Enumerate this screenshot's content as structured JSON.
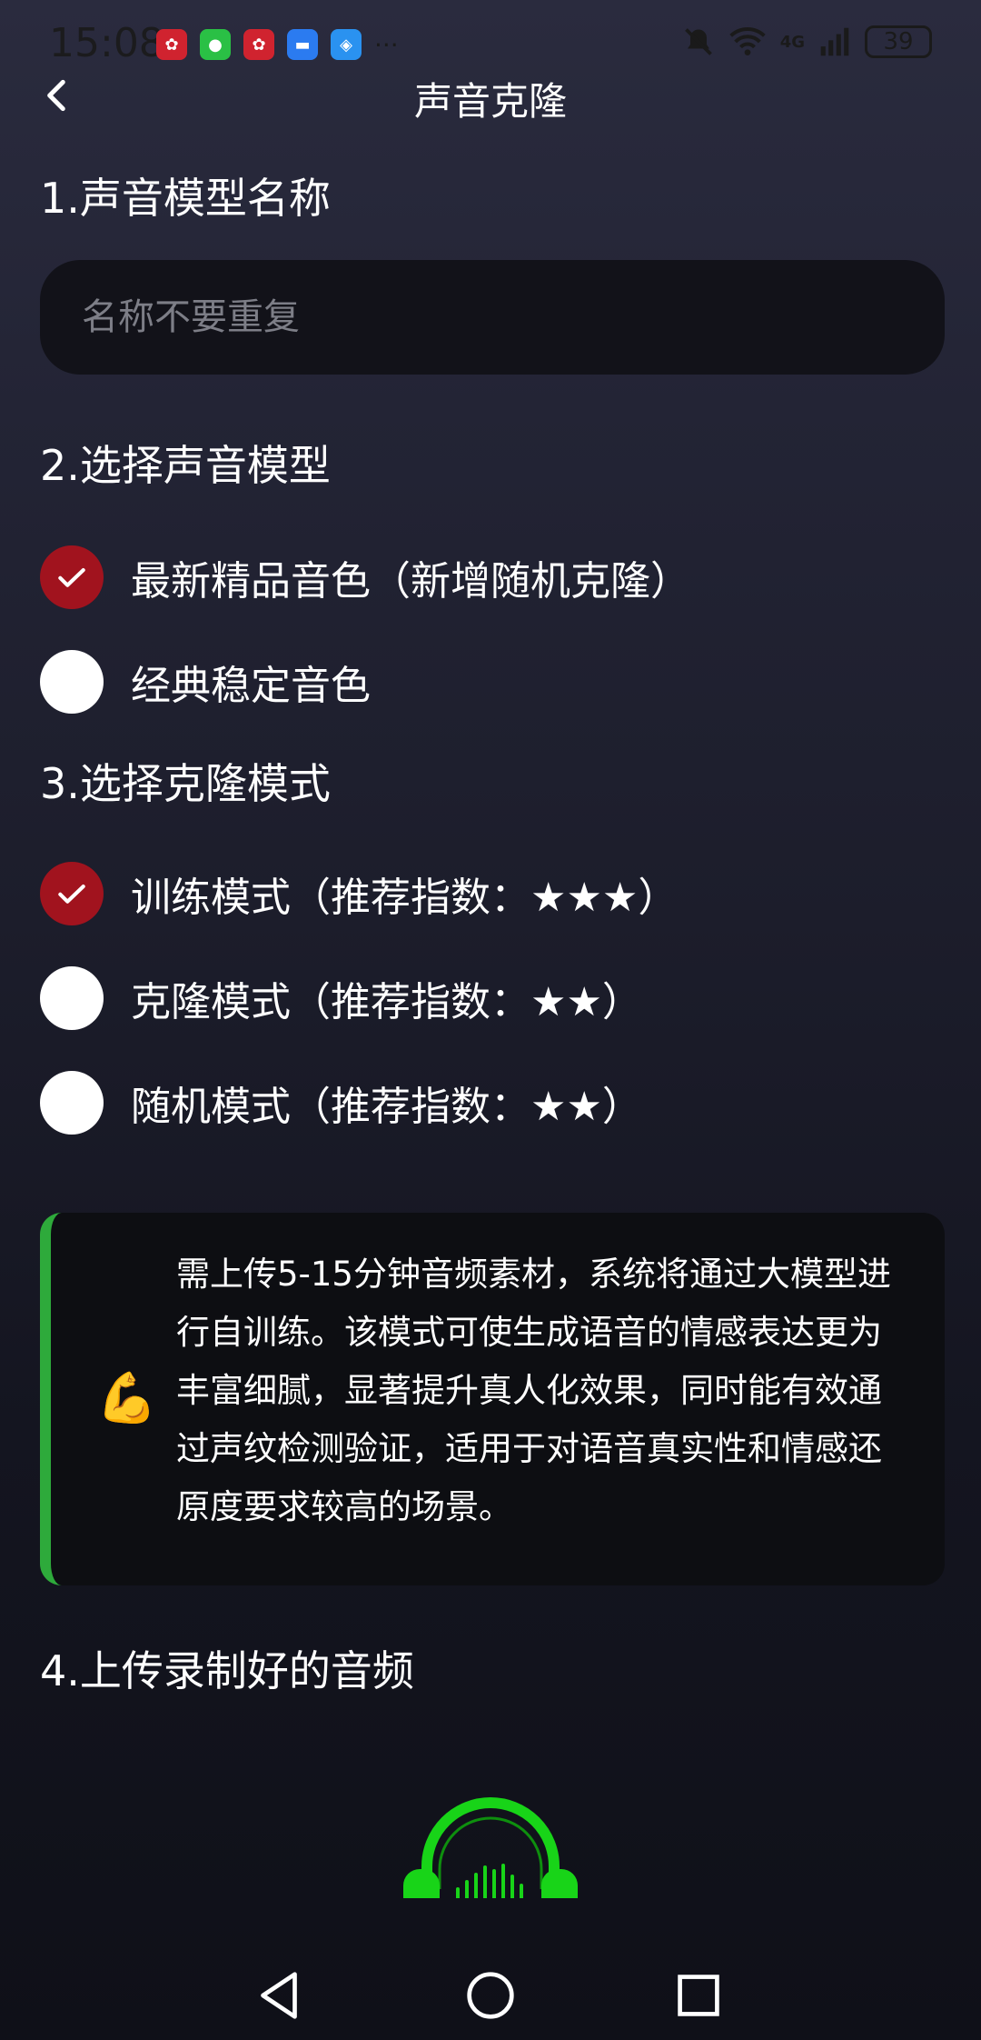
{
  "status": {
    "time": "15:08",
    "notif_more": "···",
    "network": "4G",
    "battery": "39"
  },
  "header": {
    "title": "声音克隆"
  },
  "section1": {
    "title": "1.声音模型名称",
    "input_placeholder": "名称不要重复",
    "input_value": ""
  },
  "section2": {
    "title": "2.选择声音模型",
    "options": [
      {
        "label": "最新精品音色（新增随机克隆）",
        "checked": true
      },
      {
        "label": "经典稳定音色",
        "checked": false
      }
    ]
  },
  "section3": {
    "title": "3.选择克隆模式",
    "options": [
      {
        "label": "训练模式（推荐指数：★★★）",
        "checked": true
      },
      {
        "label": "克隆模式（推荐指数：★★）",
        "checked": false
      },
      {
        "label": "随机模式（推荐指数：★★）",
        "checked": false
      }
    ]
  },
  "info": {
    "emoji": "💪",
    "text": "需上传5-15分钟音频素材，系统将通过大模型进行自训练。该模式可使生成语音的情感表达更为丰富细腻，显著提升真人化效果，同时能有效通过声纹检测验证，适用于对语音真实性和情感还原度要求较高的场景。"
  },
  "section4": {
    "title": "4.上传录制好的音频"
  },
  "colors": {
    "accent_red": "#a1131e",
    "accent_green": "#2eaa3b",
    "headphones_green": "#18d418"
  },
  "icons": {
    "back": "chevron-left-icon",
    "upload": "headphones-icon"
  }
}
